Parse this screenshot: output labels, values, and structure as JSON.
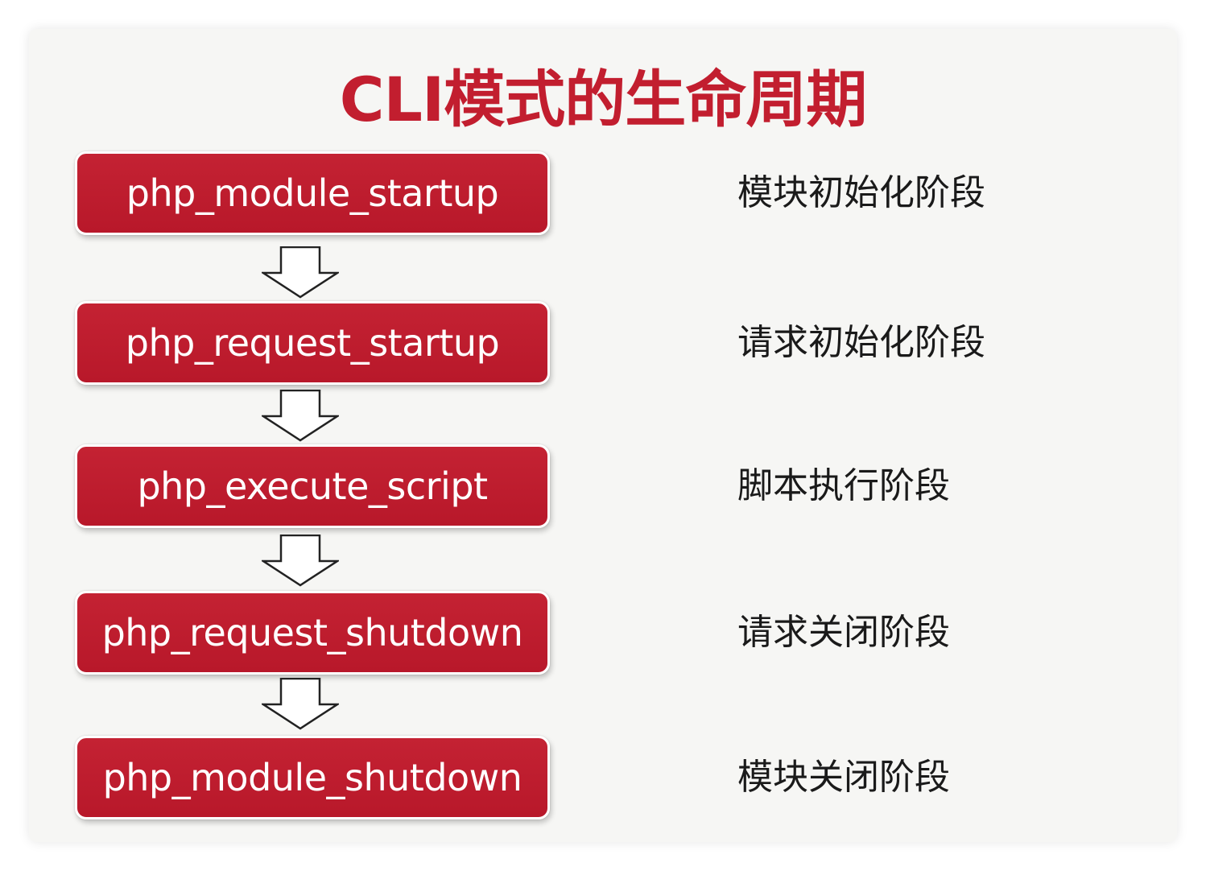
{
  "title": "CLI模式的生命周期",
  "steps": [
    {
      "label": "php_module_startup",
      "stage": "模块初始化阶段"
    },
    {
      "label": "php_request_startup",
      "stage": "请求初始化阶段"
    },
    {
      "label": "php_execute_script",
      "stage": "脚本执行阶段"
    },
    {
      "label": "php_request_shutdown",
      "stage": "请求关闭阶段"
    },
    {
      "label": "php_module_shutdown",
      "stage": "模块关闭阶段"
    }
  ],
  "colors": {
    "accent": "#c21e2f",
    "box_fill": "#bd1d2e",
    "background": "#f6f6f4"
  },
  "icons": {
    "connector": "arrow-down-outline-icon"
  }
}
